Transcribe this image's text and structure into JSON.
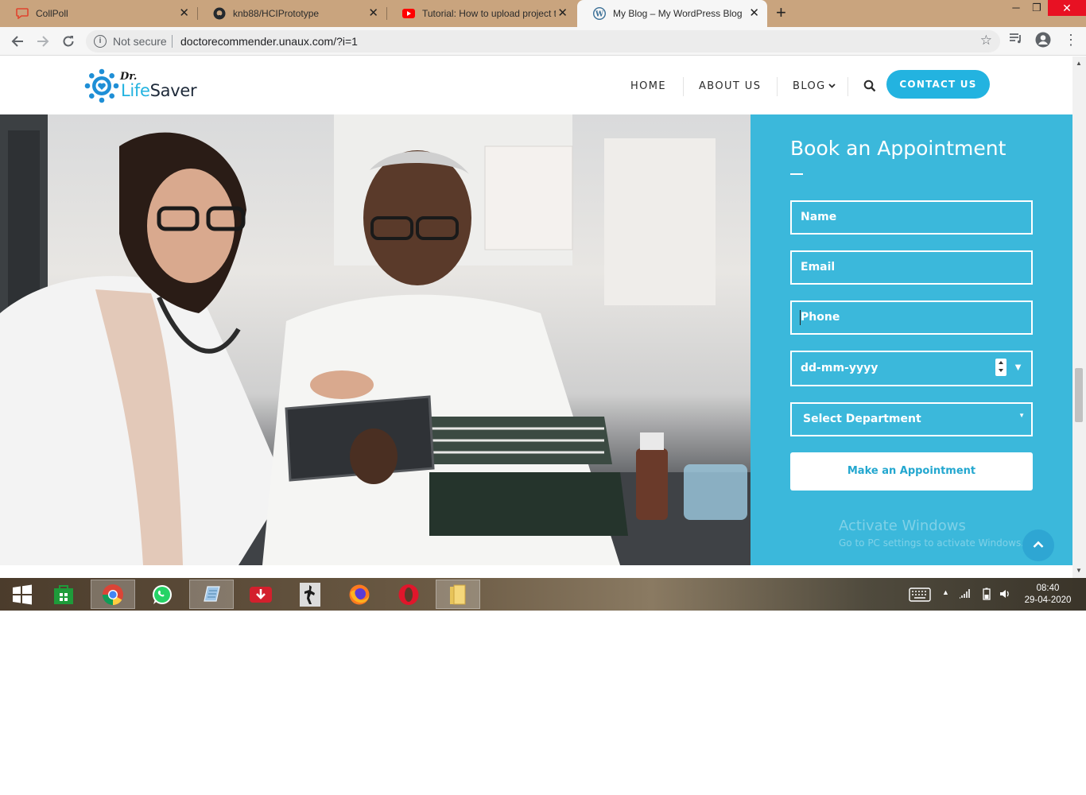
{
  "browser": {
    "tabs": [
      {
        "title": "CollPoll",
        "active": false
      },
      {
        "title": "knb88/HCIPrototype",
        "active": false
      },
      {
        "title": "Tutorial: How to upload project t",
        "active": false
      },
      {
        "title": "My Blog – My WordPress Blog",
        "active": true
      }
    ],
    "security_label": "Not secure",
    "url": "doctorecommender.unaux.com/?i=1"
  },
  "site": {
    "logo": {
      "prefix": "Dr.",
      "name_part1": "Life",
      "name_part2": "Saver"
    },
    "nav": {
      "home": "HOME",
      "about": "ABOUT US",
      "blog": "BLOG"
    },
    "cta": "CONTACT US"
  },
  "booking": {
    "title": "Book an Appointment",
    "name_placeholder": "Name",
    "email_placeholder": "Email",
    "phone_placeholder": "Phone",
    "date_placeholder": "dd-mm-yyyy",
    "department_selected": "Select Department",
    "submit_label": "Make an Appointment"
  },
  "watermark": {
    "line1": "Activate Windows",
    "line2": "Go to PC settings to activate Windows."
  },
  "taskbar": {
    "time": "08:40",
    "date": "29-04-2020"
  },
  "colors": {
    "accent": "#23b3e0",
    "booking_panel": "#3bb8db",
    "tab_strip": "#c9a47e"
  }
}
